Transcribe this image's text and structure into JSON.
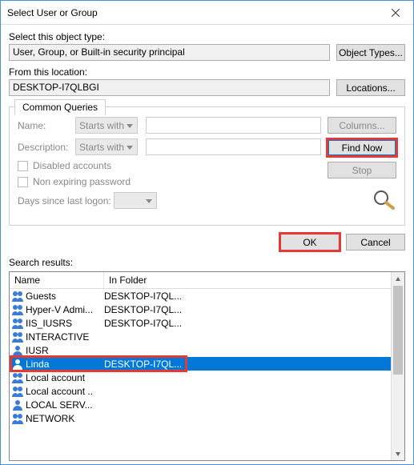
{
  "title": "Select User or Group",
  "objectType": {
    "label": "Select this object type:",
    "value": "User, Group, or Built-in security principal",
    "button": "Object Types..."
  },
  "location": {
    "label": "From this location:",
    "value": "DESKTOP-I7QLBGI",
    "button": "Locations..."
  },
  "queries": {
    "tab": "Common Queries",
    "nameLabel": "Name:",
    "descLabel": "Description:",
    "matcher": "Starts with",
    "disabled": "Disabled accounts",
    "nonexp": "Non expiring password",
    "daysLabel": "Days since last logon:",
    "columns": "Columns...",
    "findNow": "Find Now",
    "stop": "Stop"
  },
  "ok": "OK",
  "cancel": "Cancel",
  "searchResultsLabel": "Search results:",
  "headers": {
    "name": "Name",
    "folder": "In Folder"
  },
  "rows": [
    {
      "name": "Guests",
      "folder": "DESKTOP-I7QL...",
      "icon": "group"
    },
    {
      "name": "Hyper-V Admi...",
      "folder": "DESKTOP-I7QL...",
      "icon": "group"
    },
    {
      "name": "IIS_IUSRS",
      "folder": "DESKTOP-I7QL...",
      "icon": "group"
    },
    {
      "name": "INTERACTIVE",
      "folder": "",
      "icon": "group"
    },
    {
      "name": "IUSR",
      "folder": "",
      "icon": "user"
    },
    {
      "name": "Linda",
      "folder": "DESKTOP-I7QL...",
      "icon": "user",
      "selected": true
    },
    {
      "name": "Local account",
      "folder": "",
      "icon": "group"
    },
    {
      "name": "Local account ..",
      "folder": "",
      "icon": "group"
    },
    {
      "name": "LOCAL SERV...",
      "folder": "",
      "icon": "user"
    },
    {
      "name": "NETWORK",
      "folder": "",
      "icon": "group"
    }
  ]
}
